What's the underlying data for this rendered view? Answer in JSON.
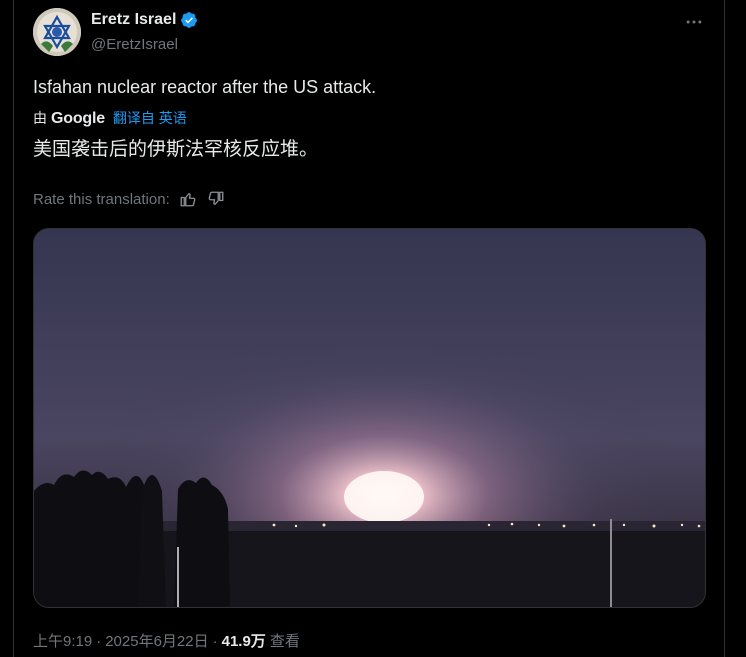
{
  "author": {
    "display_name": "Eretz Israel",
    "handle": "@EretzIsrael",
    "verified": true
  },
  "tweet": {
    "text": "Isfahan nuclear reactor after the US attack.",
    "translation": {
      "by_label": "由",
      "provider": "Google",
      "translated_from": "翻译自 英语",
      "translated_text": "美国袭击后的伊斯法罕核反应堆。"
    },
    "rate_label": "Rate this translation:"
  },
  "meta": {
    "time": "上午9:19",
    "dot1": "·",
    "date": "2025年6月22日",
    "dot2": "·",
    "views_count": "41.9万",
    "views_label": "查看"
  },
  "icons": {
    "verified": "verified-badge-icon",
    "more": "more-icon",
    "thumbs_up": "thumbs-up-icon",
    "thumbs_down": "thumbs-down-icon"
  },
  "colors": {
    "background": "#000000",
    "accent": "#1d9bf0",
    "muted": "#71767b",
    "text": "#e7e9ea"
  }
}
